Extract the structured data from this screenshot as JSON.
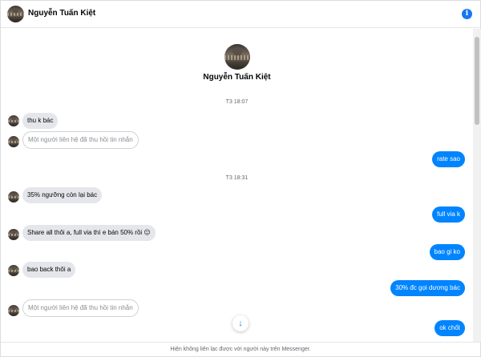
{
  "header": {
    "contact_name": "Nguyễn Tuấn Kiệt",
    "info_icon": "i"
  },
  "profile": {
    "name": "Nguyễn Tuấn Kiệt"
  },
  "timestamps": [
    "T3 18:07",
    "T3 18:31"
  ],
  "messages": [
    {
      "from": "them",
      "text": "thu k bác"
    },
    {
      "from": "them",
      "text": "Một người liên hệ đã thu hồi tin nhắn",
      "retracted": true
    },
    {
      "from": "me",
      "text": "rate sao"
    },
    {
      "from": "them",
      "text": "35% ngưỡng còn lại bác"
    },
    {
      "from": "me",
      "text": "full via k"
    },
    {
      "from": "them",
      "text": "Share all thôi a, full via thì e bán 50% rồi 😐"
    },
    {
      "from": "me",
      "text": "bao gi ko"
    },
    {
      "from": "them",
      "text": "bao back thôi a"
    },
    {
      "from": "me",
      "text": "30% đc gọi dương bác"
    },
    {
      "from": "them",
      "text": "Một người liên hệ đã thu hồi tin nhắn",
      "retracted": true
    },
    {
      "from": "me",
      "text": "ok chốt"
    }
  ],
  "scroll_down_glyph": "↓",
  "footer": {
    "notice": "Hiện không liên lạc được với người này trên Messenger."
  },
  "colors": {
    "accent": "#0084ff",
    "incoming_bubble": "#e4e6eb",
    "info": "#1877f2"
  }
}
